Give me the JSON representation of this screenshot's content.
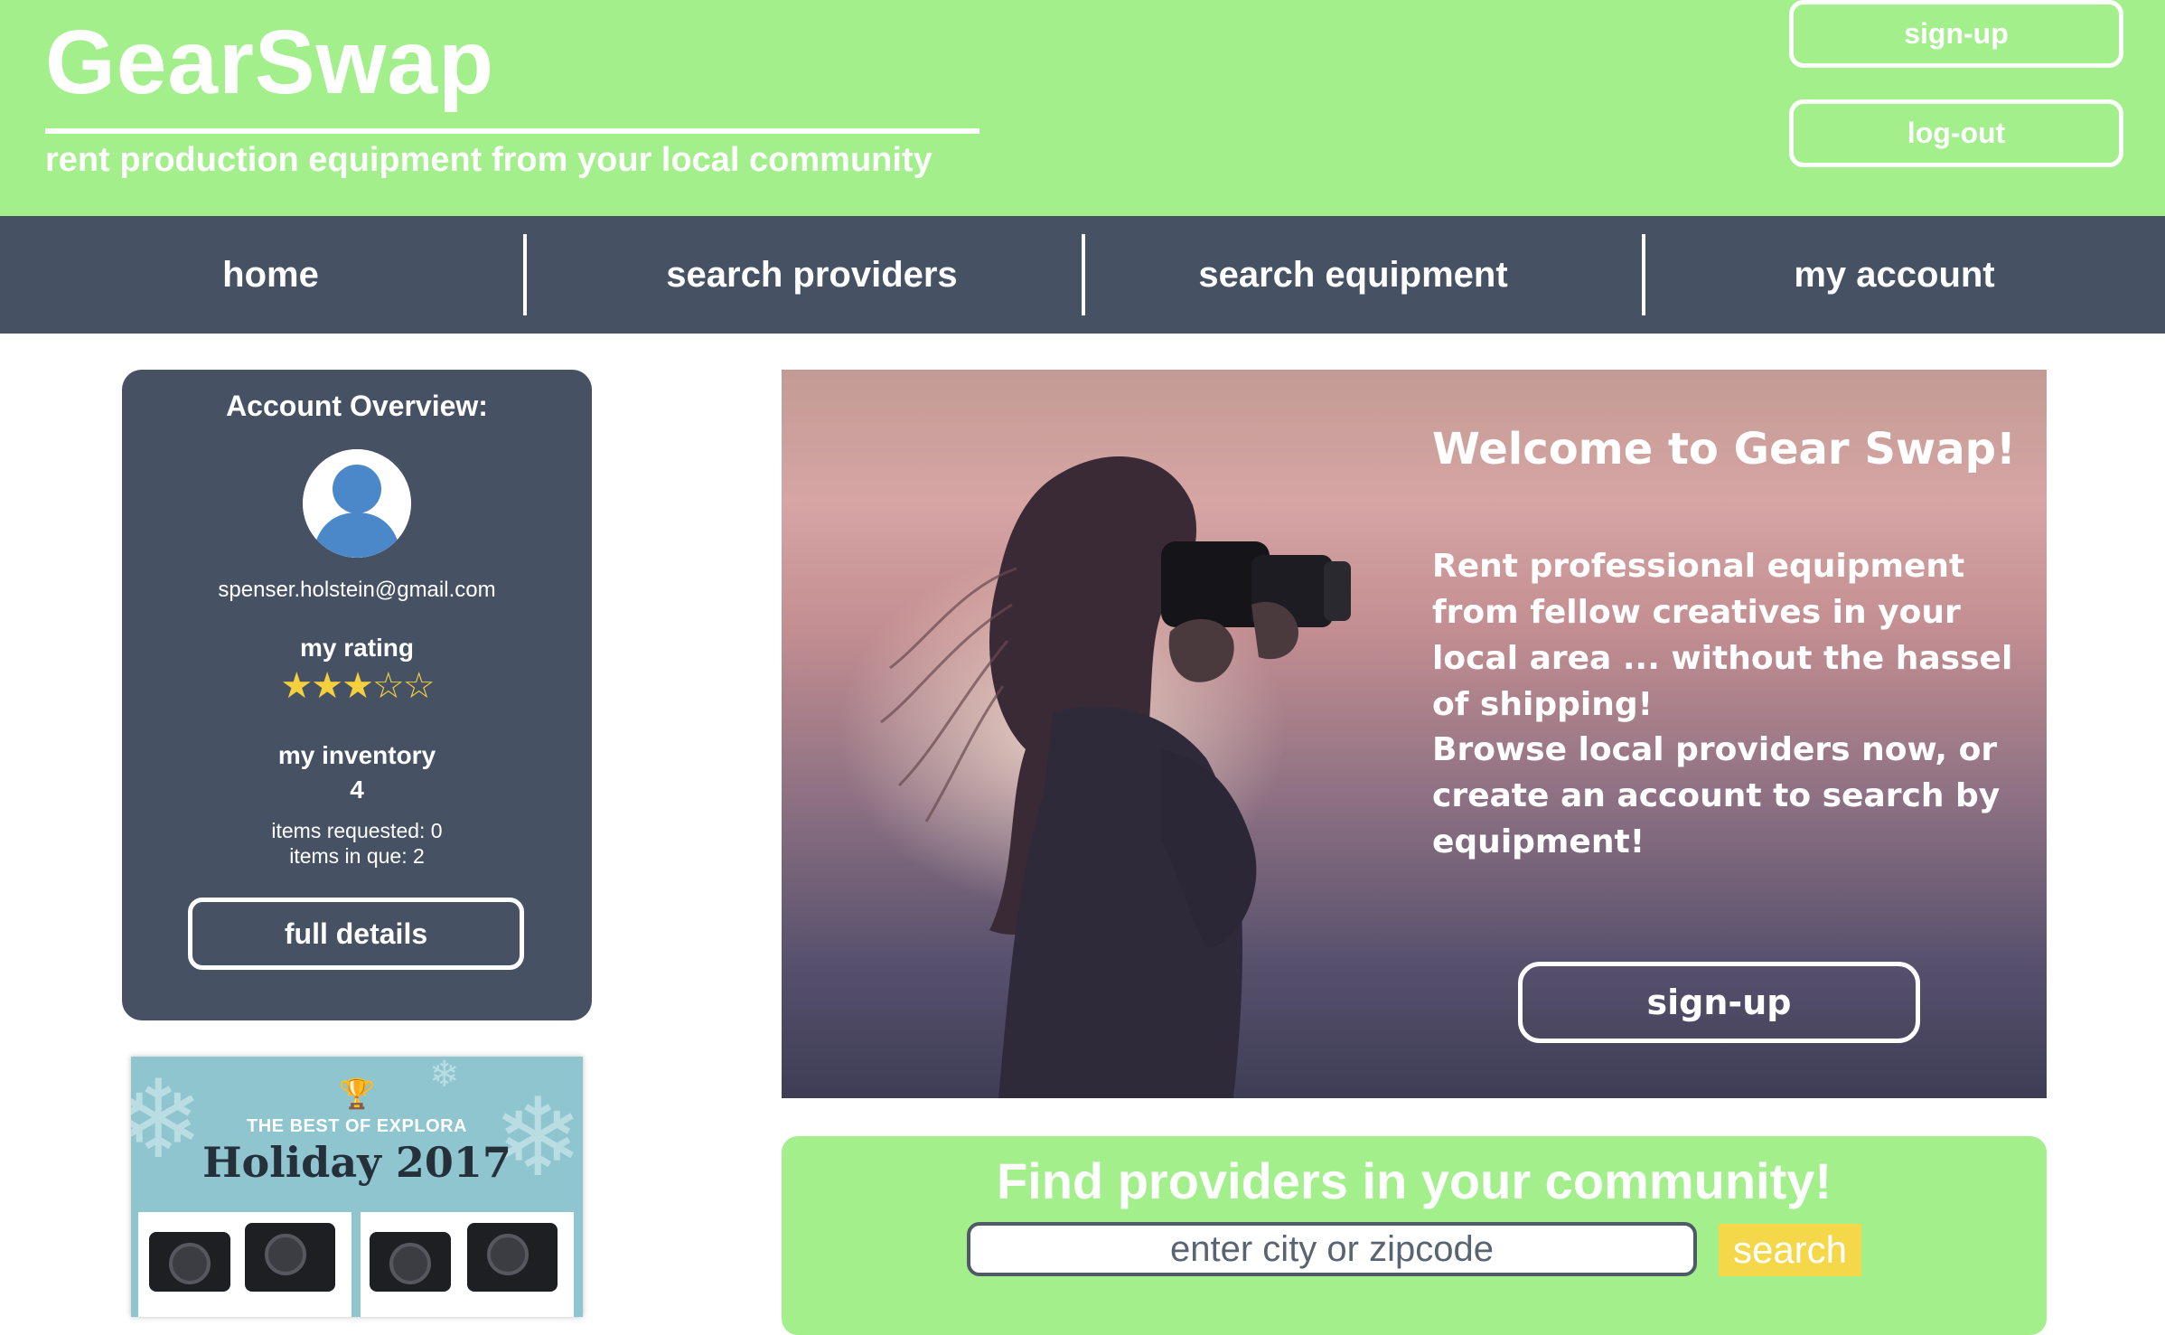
{
  "header": {
    "logo": "GearSwap",
    "tagline": "rent production equipment from your local community",
    "signup_label": "sign-up",
    "logout_label": "log-out"
  },
  "nav": {
    "items": [
      {
        "label": "home"
      },
      {
        "label": "search providers"
      },
      {
        "label": "search equipment"
      },
      {
        "label": "my account"
      }
    ]
  },
  "account": {
    "title": "Account Overview:",
    "avatar_icon": "user-avatar-icon",
    "email": "spenser.holstein@gmail.com",
    "rating_label": "my rating",
    "rating_value": 3,
    "rating_max": 5,
    "inventory_label": "my inventory",
    "inventory_count": "4",
    "items_requested": "items requested: 0",
    "items_in_que": "items in que: 2",
    "details_label": "full details"
  },
  "ad": {
    "icon": "trophy-icon",
    "kicker": "THE BEST OF EXPLORA",
    "title": "Holiday 2017"
  },
  "hero": {
    "title": "Welcome to Gear Swap!",
    "paragraph1": "Rent professional equipment from fellow creatives in your local area ... without the hassel of shipping!",
    "paragraph2": "Browse local providers now, or create an account to search  by equipment!",
    "signup_label": "sign-up"
  },
  "finder": {
    "title": "Find providers in your community!",
    "placeholder": "enter city or zipcode",
    "search_label": "search"
  },
  "colors": {
    "brand_green": "#a2ef8c",
    "nav_slate": "#465264",
    "star_gold": "#f4d03f",
    "search_yellow": "#f5d84a",
    "avatar_blue": "#4a88c9"
  }
}
